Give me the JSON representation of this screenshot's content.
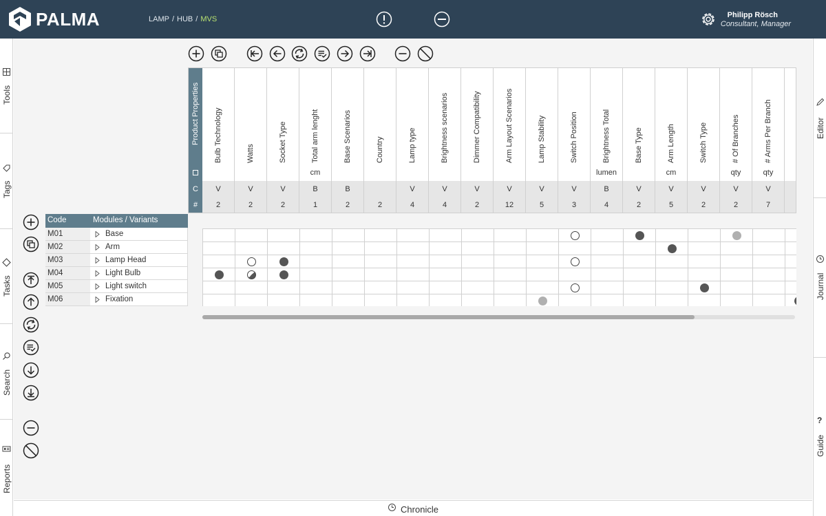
{
  "app": {
    "brand": "PALMA"
  },
  "breadcrumb": [
    "LAMP",
    "HUB",
    "MVS"
  ],
  "user": {
    "name": "Philipp Rösch",
    "role": "Consultant, Manager"
  },
  "left_nav": [
    {
      "label": "Tools",
      "icon": "tools-icon"
    },
    {
      "label": "Tags",
      "icon": "tag-icon"
    },
    {
      "label": "Tasks",
      "icon": "diamond-icon"
    },
    {
      "label": "Search",
      "icon": "search-icon"
    },
    {
      "label": "Reports",
      "icon": "report-icon"
    }
  ],
  "right_nav": [
    {
      "label": "Editor",
      "icon": "pencil-icon"
    },
    {
      "label": "Journal",
      "icon": "clock-icon"
    },
    {
      "label": "Guide",
      "icon": "question-icon"
    }
  ],
  "footer": {
    "label": "Chronicle"
  },
  "properties": {
    "title": "Product Properties",
    "row_c_symbol": "C",
    "row_n_symbol": "#",
    "columns": [
      {
        "name": "Bulb Technology",
        "unit": "",
        "c": "V",
        "n": "2"
      },
      {
        "name": "Watts",
        "unit": "",
        "c": "V",
        "n": "2"
      },
      {
        "name": "Socket Type",
        "unit": "",
        "c": "V",
        "n": "2"
      },
      {
        "name": "Total arm lenght",
        "unit": "cm",
        "c": "B",
        "n": "1"
      },
      {
        "name": "Base Scenarios",
        "unit": "",
        "c": "B",
        "n": "2"
      },
      {
        "name": "Country",
        "unit": "",
        "c": "",
        "n": "2"
      },
      {
        "name": "Lamp type",
        "unit": "",
        "c": "V",
        "n": "4"
      },
      {
        "name": "Brightness scenarios",
        "unit": "",
        "c": "V",
        "n": "4"
      },
      {
        "name": "Dimmer Compatibility",
        "unit": "",
        "c": "V",
        "n": "2"
      },
      {
        "name": "Arm Layout Scenarios",
        "unit": "",
        "c": "V",
        "n": "12"
      },
      {
        "name": "Lamp Stability",
        "unit": "",
        "c": "V",
        "n": "5"
      },
      {
        "name": "Switch Position",
        "unit": "",
        "c": "V",
        "n": "3"
      },
      {
        "name": "Brightness Total",
        "unit": "lumen",
        "c": "B",
        "n": "4"
      },
      {
        "name": "Base Type",
        "unit": "",
        "c": "V",
        "n": "2"
      },
      {
        "name": "Arm Length",
        "unit": "cm",
        "c": "V",
        "n": "5"
      },
      {
        "name": "Switch Type",
        "unit": "",
        "c": "V",
        "n": "2"
      },
      {
        "name": "# Of Branches",
        "unit": "qty",
        "c": "V",
        "n": "2"
      },
      {
        "name": "# Arms Per Branch",
        "unit": "qty",
        "c": "V",
        "n": "7"
      }
    ]
  },
  "modules": {
    "header": {
      "code": "Code",
      "name": "Modules / Variants"
    },
    "rows": [
      {
        "code": "M01",
        "name": "Base"
      },
      {
        "code": "M02",
        "name": "Arm"
      },
      {
        "code": "M03",
        "name": "Lamp Head"
      },
      {
        "code": "M04",
        "name": "Light Bulb"
      },
      {
        "code": "M05",
        "name": "Light switch"
      },
      {
        "code": "M06",
        "name": "Fixation"
      }
    ]
  },
  "matrix_marks": [
    {
      "row": 0,
      "col": 11,
      "type": "empty"
    },
    {
      "row": 0,
      "col": 13,
      "type": "filled"
    },
    {
      "row": 0,
      "col": 16,
      "type": "light"
    },
    {
      "row": 1,
      "col": 14,
      "type": "filled"
    },
    {
      "row": 2,
      "col": 1,
      "type": "empty"
    },
    {
      "row": 2,
      "col": 2,
      "type": "filled"
    },
    {
      "row": 2,
      "col": 11,
      "type": "empty"
    },
    {
      "row": 3,
      "col": 0,
      "type": "filled"
    },
    {
      "row": 3,
      "col": 1,
      "type": "half"
    },
    {
      "row": 3,
      "col": 2,
      "type": "filled"
    },
    {
      "row": 4,
      "col": 11,
      "type": "empty"
    },
    {
      "row": 4,
      "col": 15,
      "type": "filled"
    },
    {
      "row": 5,
      "col": 10,
      "type": "light"
    }
  ],
  "scroll": {
    "horizontal_fraction": 0.83
  }
}
